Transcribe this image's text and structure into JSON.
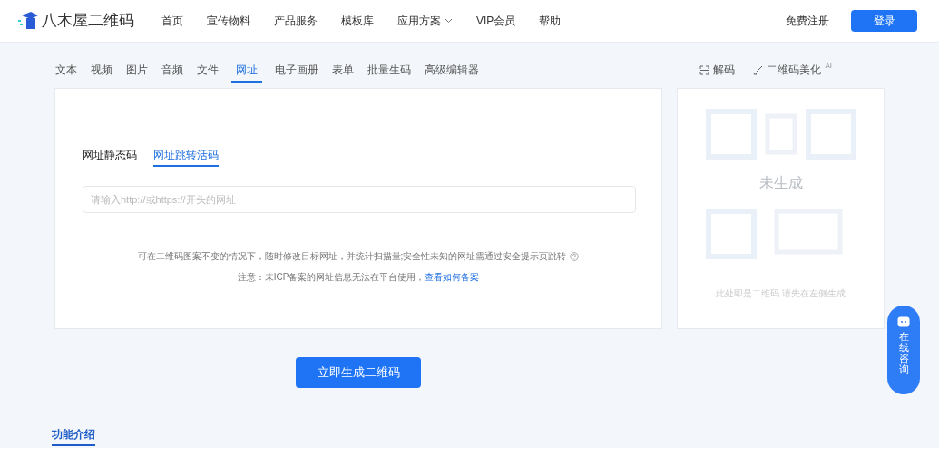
{
  "header": {
    "logo": "八木屋二维码",
    "nav": [
      {
        "label": "首页",
        "dropdown": false
      },
      {
        "label": "宣传物料",
        "dropdown": false
      },
      {
        "label": "产品服务",
        "dropdown": false
      },
      {
        "label": "模板库",
        "dropdown": false
      },
      {
        "label": "应用方案",
        "dropdown": true
      },
      {
        "label": "VIP会员",
        "dropdown": false
      },
      {
        "label": "帮助",
        "dropdown": false
      }
    ],
    "register": "免费注册",
    "login": "登录"
  },
  "type_tabs": [
    {
      "label": "文本",
      "selected": false
    },
    {
      "label": "视频",
      "selected": false
    },
    {
      "label": "图片",
      "selected": false
    },
    {
      "label": "音频",
      "selected": false
    },
    {
      "label": "文件",
      "selected": false
    },
    {
      "label": "网址",
      "selected": true
    },
    {
      "label": "电子画册",
      "selected": false
    },
    {
      "label": "表单",
      "selected": false
    },
    {
      "label": "批量生码",
      "selected": false
    },
    {
      "label": "高级编辑器",
      "selected": false
    }
  ],
  "tools": {
    "decode": "解码",
    "beautify": "二维码美化",
    "beautify_badge": "AI"
  },
  "mode_tabs": [
    {
      "label": "网址静态码",
      "selected": false
    },
    {
      "label": "网址跳转活码",
      "selected": true
    }
  ],
  "url_field": {
    "placeholder": "请输入http://或https://开头的网址"
  },
  "hint": "可在二维码图案不变的情况下，随时修改目标网址，并统计扫描量;安全性未知的网址需通过安全提示页跳转",
  "notice": "注意：未ICP备案的网址信息无法在平台使用，",
  "notice_link": "查看如何备案",
  "preview": {
    "overlay": "未生成",
    "caption": "此处即是二维码 请先在左侧生成"
  },
  "generate_button": "立即生成二维码",
  "section_tab": "功能介绍",
  "consult": "在线咨询"
}
